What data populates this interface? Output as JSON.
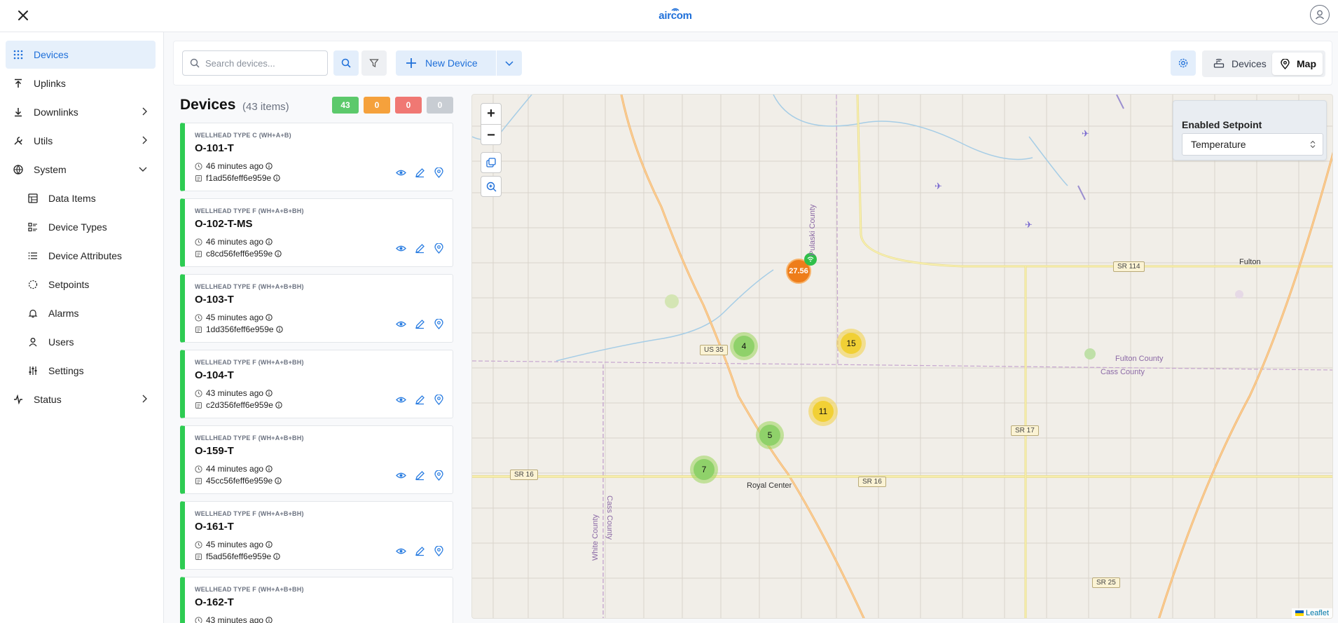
{
  "app": {
    "brand": "aircom"
  },
  "sidebar": {
    "items": [
      {
        "label": "Devices"
      },
      {
        "label": "Uplinks"
      },
      {
        "label": "Downlinks"
      },
      {
        "label": "Utils"
      },
      {
        "label": "System"
      },
      {
        "label": "Data Items"
      },
      {
        "label": "Device Types"
      },
      {
        "label": "Device Attributes"
      },
      {
        "label": "Setpoints"
      },
      {
        "label": "Alarms"
      },
      {
        "label": "Users"
      },
      {
        "label": "Settings"
      },
      {
        "label": "Status"
      }
    ]
  },
  "toolbar": {
    "search_placeholder": "Search devices...",
    "new_device_label": "New Device",
    "view_devices_label": "Devices",
    "view_map_label": "Map"
  },
  "list": {
    "title": "Devices",
    "count": "(43 items)",
    "badges": [
      {
        "value": "43",
        "color": "#5cc96b"
      },
      {
        "value": "0",
        "color": "#f5a13c"
      },
      {
        "value": "0",
        "color": "#f07873"
      },
      {
        "value": "0",
        "color": "#c8cdd3"
      }
    ]
  },
  "devices": [
    {
      "type": "WELLHEAD TYPE C (WH+A+B)",
      "name": "O-101-T",
      "time": "46 minutes ago",
      "hash": "f1ad56feff6e959e"
    },
    {
      "type": "WELLHEAD TYPE F (WH+A+B+BH)",
      "name": "O-102-T-MS",
      "time": "46 minutes ago",
      "hash": "c8cd56feff6e959e"
    },
    {
      "type": "WELLHEAD TYPE F (WH+A+B+BH)",
      "name": "O-103-T",
      "time": "45 minutes ago",
      "hash": "1dd356feff6e959e"
    },
    {
      "type": "WELLHEAD TYPE F (WH+A+B+BH)",
      "name": "O-104-T",
      "time": "43 minutes ago",
      "hash": "c2d356feff6e959e"
    },
    {
      "type": "WELLHEAD TYPE F (WH+A+B+BH)",
      "name": "O-159-T",
      "time": "44 minutes ago",
      "hash": "45cc56feff6e959e"
    },
    {
      "type": "WELLHEAD TYPE F (WH+A+B+BH)",
      "name": "O-161-T",
      "time": "45 minutes ago",
      "hash": "f5ad56feff6e959e"
    },
    {
      "type": "WELLHEAD TYPE F (WH+A+B+BH)",
      "name": "O-162-T",
      "time": "43 minutes ago",
      "hash": ""
    }
  ],
  "map": {
    "setpoint_label": "Enabled Setpoint",
    "setpoint_value": "Temperature",
    "clusters": [
      {
        "count": "4"
      },
      {
        "count": "15"
      },
      {
        "count": "11"
      },
      {
        "count": "5"
      },
      {
        "count": "7"
      }
    ],
    "orange_marker": "27.56",
    "labels": {
      "royal_center": "Royal Center",
      "fulton": "Fulton",
      "fulton_county": "Fulton County",
      "cass_county": "Cass County",
      "pulaski_county": "Pulaski County",
      "cass_county_v": "Cass County",
      "white_county": "White County"
    },
    "shields": {
      "us35": "US 35",
      "sr114": "SR 114",
      "sr17": "SR 17",
      "sr16_left": "SR 16",
      "sr16_right": "SR 16",
      "sr25": "SR 25"
    },
    "attribution": "Leaflet"
  }
}
